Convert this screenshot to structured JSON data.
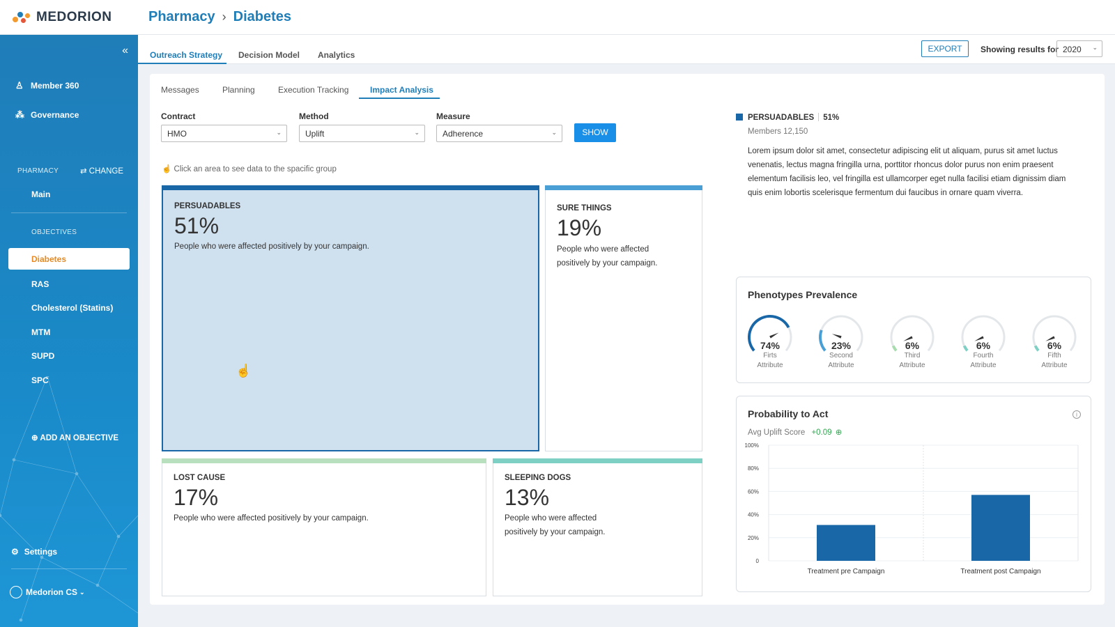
{
  "app": {
    "brand": "MEDORION"
  },
  "breadcrumb": {
    "section": "Pharmacy",
    "separator": "›",
    "page": "Diabetes"
  },
  "sidebar": {
    "nav": [
      {
        "label": "Member 360",
        "icon": "person-icon"
      },
      {
        "label": "Governance",
        "icon": "network-icon"
      }
    ],
    "pharmacy_label": "PHARMACY",
    "change_label": "CHANGE",
    "main_label": "Main",
    "objectives_label": "OBJECTIVES",
    "objectives": [
      "Diabetes",
      "RAS",
      "Cholesterol (Statins)",
      "MTM",
      "SUPD",
      "SPC"
    ],
    "active_objective": "Diabetes",
    "add_objective": "ADD AN OBJECTIVE",
    "settings": "Settings",
    "user": "Medorion CS"
  },
  "top_tabs": [
    "Outreach Strategy",
    "Decision Model",
    "Analytics"
  ],
  "export_label": "EXPORT",
  "showing_label": "Showing results for",
  "year": "2020",
  "sub_tabs": [
    "Messages",
    "Planning",
    "Execution Tracking",
    "Impact Analysis"
  ],
  "filters": {
    "contract": {
      "label": "Contract",
      "value": "HMO"
    },
    "method": {
      "label": "Method",
      "value": "Uplift"
    },
    "measure": {
      "label": "Measure",
      "value": "Adherence"
    },
    "show_label": "SHOW"
  },
  "hint": "Click an area to see data to the spacific group",
  "quadrants": {
    "persuadables": {
      "name": "PERSUADABLES",
      "pct": "51%",
      "desc": "People who were affected positively by your campaign.",
      "color": "#1a67a8"
    },
    "sure_things": {
      "name": "SURE THINGS",
      "pct": "19%",
      "desc1": "People who were affected",
      "desc2": "positively by your campaign.",
      "color": "#4a9fd4"
    },
    "lost_cause": {
      "name": "LOST CAUSE",
      "pct": "17%",
      "desc": "People who were affected positively by your campaign.",
      "color": "#b8e0bf"
    },
    "sleeping_dogs": {
      "name": "SLEEPING DOGS",
      "pct": "13%",
      "desc1": "People who were affected",
      "desc2": "positively by your campaign.",
      "color": "#7fd0c4"
    }
  },
  "detail": {
    "name": "PERSUADABLES",
    "pct": "51%",
    "members": "Members 12,150",
    "text": "Lorem ipsum dolor sit amet, consectetur adipiscing elit ut aliquam, purus sit amet luctus venenatis, lectus magna fringilla urna, porttitor rhoncus dolor purus non enim praesent elementum facilisis leo, vel fringilla est ullamcorper eget nulla facilisi etiam dignissim diam quis enim lobortis scelerisque fermentum dui faucibus in ornare quam viverra."
  },
  "phenotypes": {
    "title": "Phenotypes Prevalence",
    "gauges": [
      {
        "value": "74%",
        "fraction": 0.74,
        "line1": "Firts",
        "line2": "Attribute",
        "color": "#1a67a8"
      },
      {
        "value": "23%",
        "fraction": 0.23,
        "line1": "Second",
        "line2": "Attribute",
        "color": "#4a9fd4"
      },
      {
        "value": "6%",
        "fraction": 0.06,
        "line1": "Third",
        "line2": "Attribute",
        "color": "#a8dcae"
      },
      {
        "value": "6%",
        "fraction": 0.06,
        "line1": "Fourth",
        "line2": "Attribute",
        "color": "#7fd0c4"
      },
      {
        "value": "6%",
        "fraction": 0.06,
        "line1": "Fifth",
        "line2": "Attribute",
        "color": "#7fd0c4"
      }
    ]
  },
  "probability": {
    "title": "Probability to Act",
    "avg_label": "Avg Uplift Score",
    "avg_value": "+0.09"
  },
  "chart_data": {
    "type": "bar",
    "categories": [
      "Treatment pre Campaign",
      "Treatment post Campaign"
    ],
    "values": [
      31,
      57
    ],
    "yticks": [
      "100%",
      "80%",
      "60%",
      "40%",
      "20%",
      "0"
    ],
    "ylim": [
      0,
      100
    ],
    "color": "#1a67a8"
  }
}
